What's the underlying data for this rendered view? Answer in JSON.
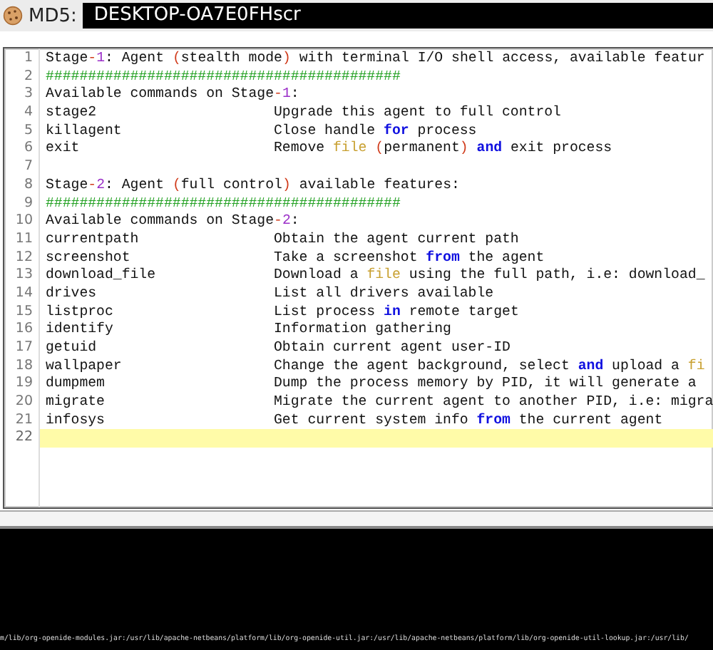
{
  "header": {
    "label": "MD5:",
    "value": "DESKTOP-OA7E0FHscr"
  },
  "editor": {
    "lines": [
      {
        "num": "1",
        "current": false,
        "code": [
          {
            "kind": "plain",
            "text": "Stage"
          },
          {
            "kind": "op",
            "text": "-"
          },
          {
            "kind": "number",
            "text": "1"
          },
          {
            "kind": "plain",
            "text": ": Agent "
          },
          {
            "kind": "op",
            "text": "("
          },
          {
            "kind": "plain",
            "text": "stealth mode"
          },
          {
            "kind": "op",
            "text": ")"
          },
          {
            "kind": "plain",
            "text": " with terminal I/O shell access, available featur"
          }
        ]
      },
      {
        "num": "2",
        "current": false,
        "code": [
          {
            "kind": "comment",
            "text": "##########################################"
          }
        ]
      },
      {
        "num": "3",
        "current": false,
        "code": [
          {
            "kind": "plain",
            "text": "Available commands on Stage"
          },
          {
            "kind": "op",
            "text": "-"
          },
          {
            "kind": "number",
            "text": "1"
          },
          {
            "kind": "plain",
            "text": ":"
          }
        ]
      },
      {
        "num": "4",
        "current": false,
        "command": "stage2",
        "code": [
          {
            "kind": "plain",
            "text": "Upgrade this agent to full control"
          }
        ]
      },
      {
        "num": "5",
        "current": false,
        "command": "killagent",
        "code": [
          {
            "kind": "plain",
            "text": "Close handle "
          },
          {
            "kind": "keyword",
            "text": "for"
          },
          {
            "kind": "plain",
            "text": " process"
          }
        ]
      },
      {
        "num": "6",
        "current": false,
        "command": "exit",
        "code": [
          {
            "kind": "plain",
            "text": "Remove "
          },
          {
            "kind": "builtin",
            "text": "file"
          },
          {
            "kind": "op",
            "text": " ("
          },
          {
            "kind": "plain",
            "text": "permanent"
          },
          {
            "kind": "op",
            "text": ") "
          },
          {
            "kind": "keyword",
            "text": "and"
          },
          {
            "kind": "plain",
            "text": " exit process"
          }
        ]
      },
      {
        "num": "7",
        "current": false
      },
      {
        "num": "8",
        "current": false,
        "code": [
          {
            "kind": "plain",
            "text": "Stage"
          },
          {
            "kind": "op",
            "text": "-"
          },
          {
            "kind": "number",
            "text": "2"
          },
          {
            "kind": "plain",
            "text": ": Agent "
          },
          {
            "kind": "op",
            "text": "("
          },
          {
            "kind": "plain",
            "text": "full control"
          },
          {
            "kind": "op",
            "text": ")"
          },
          {
            "kind": "plain",
            "text": " available features:"
          }
        ]
      },
      {
        "num": "9",
        "current": false,
        "code": [
          {
            "kind": "comment",
            "text": "##########################################"
          }
        ]
      },
      {
        "num": "10",
        "current": false,
        "code": [
          {
            "kind": "plain",
            "text": "Available commands on Stage"
          },
          {
            "kind": "op",
            "text": "-"
          },
          {
            "kind": "number",
            "text": "2"
          },
          {
            "kind": "plain",
            "text": ":"
          }
        ]
      },
      {
        "num": "11",
        "current": false,
        "command": "currentpath",
        "code": [
          {
            "kind": "plain",
            "text": "Obtain the agent current path"
          }
        ]
      },
      {
        "num": "12",
        "current": false,
        "command": "screenshot",
        "code": [
          {
            "kind": "plain",
            "text": "Take a screenshot "
          },
          {
            "kind": "keyword",
            "text": "from"
          },
          {
            "kind": "plain",
            "text": " the agent"
          }
        ]
      },
      {
        "num": "13",
        "current": false,
        "command": "download_file",
        "code": [
          {
            "kind": "plain",
            "text": "Download a "
          },
          {
            "kind": "builtin",
            "text": "file"
          },
          {
            "kind": "plain",
            "text": " using the full path, i.e: download_"
          }
        ]
      },
      {
        "num": "14",
        "current": false,
        "command": "drives",
        "code": [
          {
            "kind": "plain",
            "text": "List all drivers available"
          }
        ]
      },
      {
        "num": "15",
        "current": false,
        "command": "listproc",
        "code": [
          {
            "kind": "plain",
            "text": "List process "
          },
          {
            "kind": "keyword",
            "text": "in"
          },
          {
            "kind": "plain",
            "text": " remote target"
          }
        ]
      },
      {
        "num": "16",
        "current": false,
        "command": "identify",
        "code": [
          {
            "kind": "plain",
            "text": "Information gathering"
          }
        ]
      },
      {
        "num": "17",
        "current": false,
        "command": "getuid",
        "code": [
          {
            "kind": "plain",
            "text": "Obtain current agent user-ID"
          }
        ]
      },
      {
        "num": "18",
        "current": false,
        "command": "wallpaper",
        "code": [
          {
            "kind": "plain",
            "text": "Change the agent background, select "
          },
          {
            "kind": "keyword",
            "text": "and"
          },
          {
            "kind": "plain",
            "text": " upload a "
          },
          {
            "kind": "builtin",
            "text": "fi"
          }
        ]
      },
      {
        "num": "19",
        "current": false,
        "command": "dumpmem",
        "code": [
          {
            "kind": "plain",
            "text": "Dump the process memory by PID, it will generate a"
          }
        ]
      },
      {
        "num": "20",
        "current": false,
        "command": "migrate",
        "code": [
          {
            "kind": "plain",
            "text": "Migrate the current agent to another PID, i.e: migra"
          }
        ]
      },
      {
        "num": "21",
        "current": false,
        "command": "infosys",
        "code": [
          {
            "kind": "plain",
            "text": "Get current system info "
          },
          {
            "kind": "keyword",
            "text": "from"
          },
          {
            "kind": "plain",
            "text": " the current agent"
          }
        ]
      },
      {
        "num": "22",
        "current": true
      }
    ]
  },
  "terminal": {
    "output": "m/lib/org-openide-modules.jar:/usr/lib/apache-netbeans/platform/lib/org-openide-util.jar:/usr/lib/apache-netbeans/platform/lib/org-openide-util-lookup.jar:/usr/lib/"
  }
}
